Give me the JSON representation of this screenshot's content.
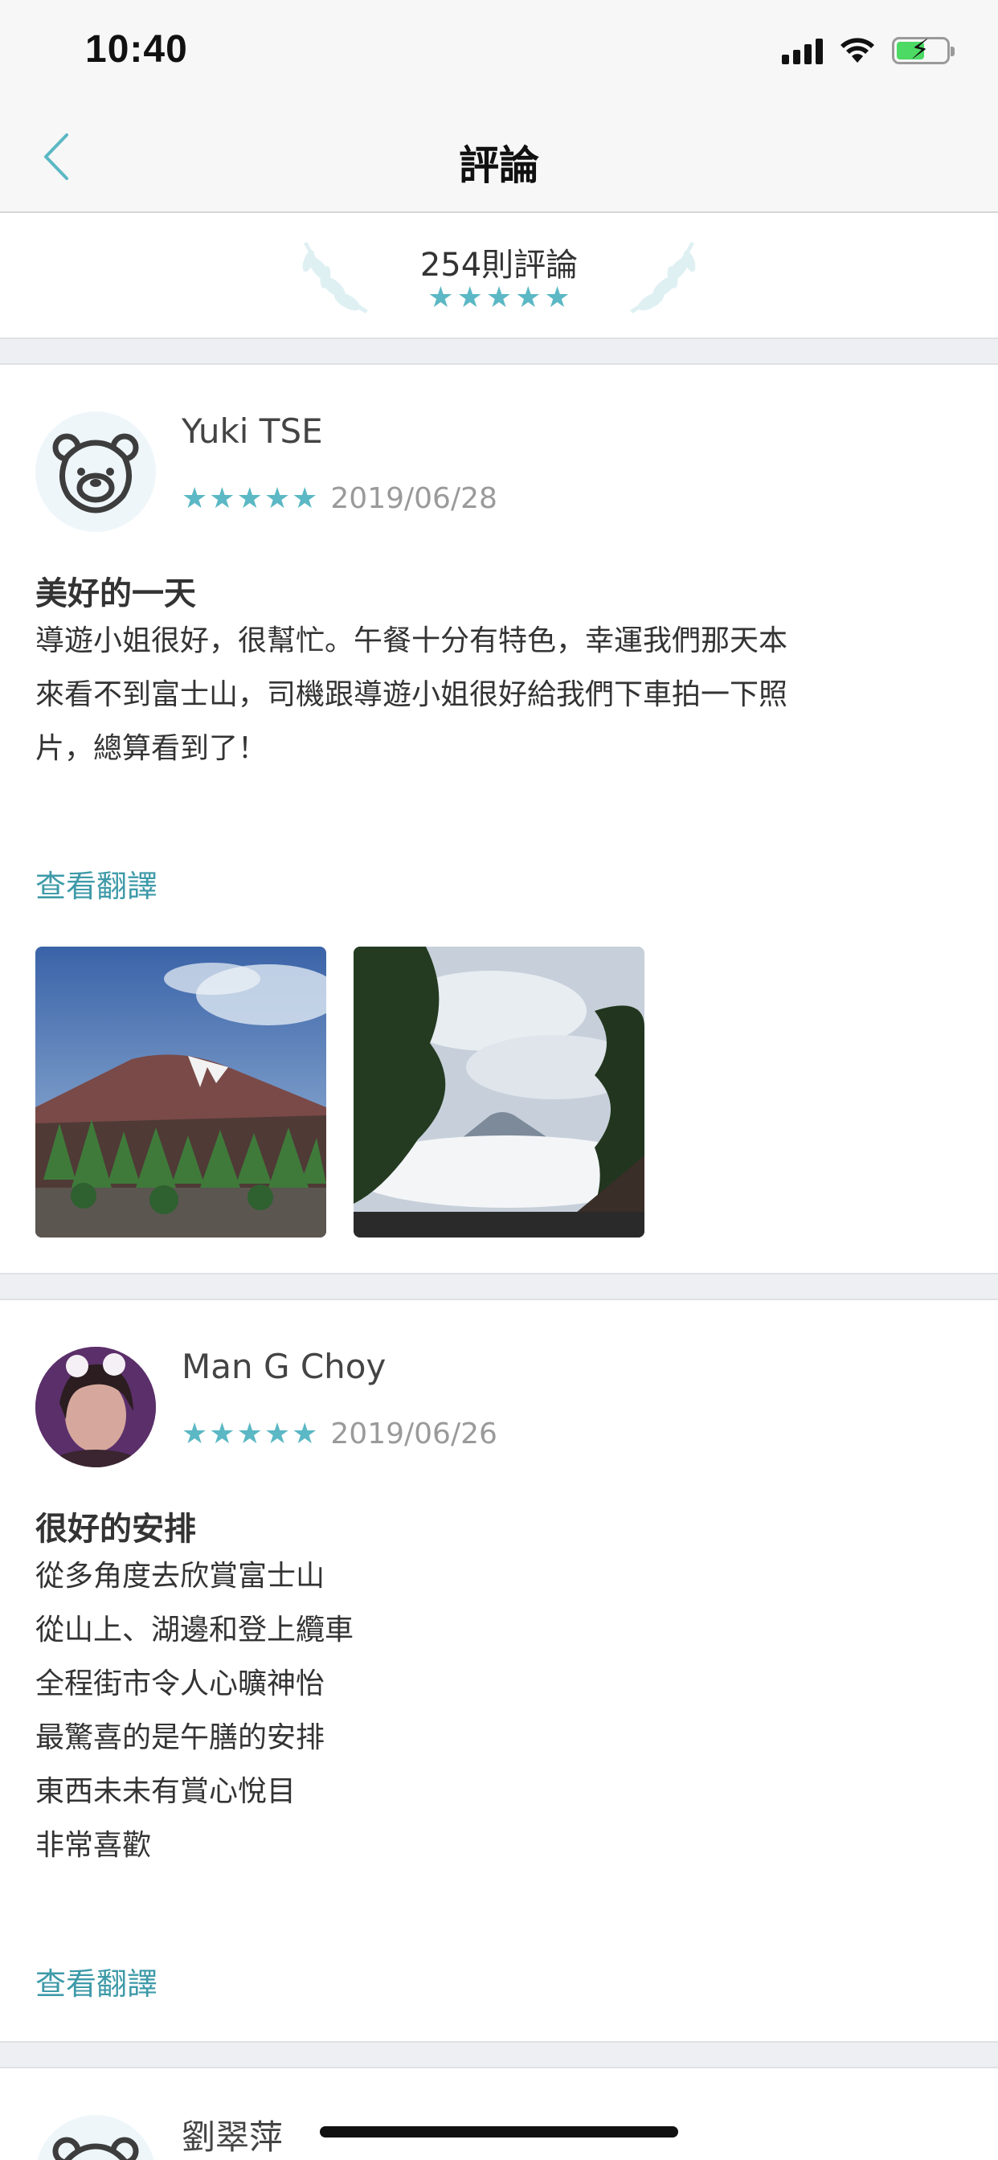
{
  "status_bar": {
    "time": "10:40"
  },
  "header": {
    "title": "評論"
  },
  "summary": {
    "count_text": "254則評論",
    "rating": 5
  },
  "reviews": [
    {
      "name": "Yuki TSE",
      "avatar": "bear-avatar",
      "rating": 5,
      "date": "2019/06/28",
      "title": "美好的一天",
      "body_lines": [
        "導遊小姐很好，很幫忙。午餐十分有特色，幸運我們那天本",
        "來看不到富士山，司機跟導遊小姐很好給我們下車拍一下照",
        "片，總算看到了！"
      ],
      "translate_label": "查看翻譯",
      "photos": [
        "mount-fuji-forest-photo",
        "mount-fuji-clouds-photo"
      ]
    },
    {
      "name": "Man G Choy",
      "avatar": "user-photo-avatar",
      "rating": 5,
      "date": "2019/06/26",
      "title": "很好的安排",
      "body_lines": [
        "從多角度去欣賞富士山",
        "從山上、湖邊和登上纜車",
        "全程街市令人心曠神怡",
        "最驚喜的是午膳的安排",
        "東西未未有賞心悅目",
        "非常喜歡"
      ],
      "translate_label": "查看翻譯"
    },
    {
      "name": "劉翠萍",
      "avatar": "bear-avatar"
    }
  ],
  "colors": {
    "accent": "#5bb8c4",
    "link": "#3e9aa8",
    "divider": "#eeeff2"
  }
}
